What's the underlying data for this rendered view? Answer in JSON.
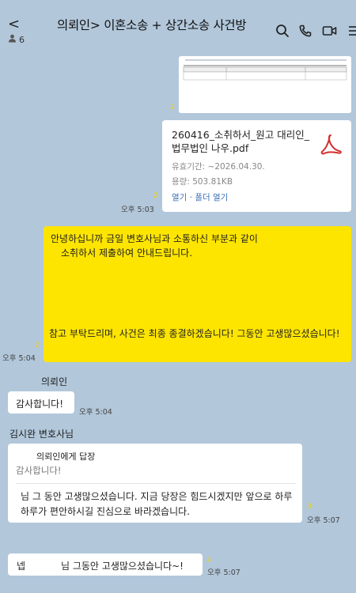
{
  "header": {
    "back": "<",
    "member_count": "6",
    "title": "의뢰인> 이혼소송 + 상간소송 사건방"
  },
  "messages": {
    "file": {
      "unread": "2",
      "name": "260416_소취하서_원고 대리인_법무법인 나우.pdf",
      "validity": "유효기간: ~2026.04.30.",
      "size": "용량: 503.81KB",
      "open": "열기",
      "sep": " · ",
      "folder": "폴더 열기",
      "time": "오후 5:03",
      "card_unread": "2"
    },
    "mine": {
      "line1": "안녕하십니까 금일 변호사님과 소통하신 부분과 같이",
      "line2": "소취하서 제출하여 안내드립니다.",
      "line3": "참고 부탁드리며, 사건은 최종 종결하겠습니다! 그동안 고생많으셨습니다!",
      "time": "오후 5:04",
      "unread": "2"
    },
    "client": {
      "sender": "의뢰인",
      "text": "감사합니다!",
      "time": "오후 5:04"
    },
    "lawyer": {
      "sender": "김시완 변호사님",
      "reply_to": "의뢰인에게 답장",
      "quote": "감사합니다!",
      "text": "님 그 동안 고생많으셨습니다. 지금 당장은 힘드시겠지만 앞으로 하루하루가 편안하시길 진심으로 바라겠습니다.",
      "unread": "3",
      "time": "오후 5:07"
    },
    "last": {
      "text_a": "넵",
      "text_b": "님 그동안 고생많으셨습니다~!",
      "unread": "4",
      "time": "오후 5:07"
    }
  },
  "colors": {
    "background": "#b2c7da",
    "my_bubble": "#fee500",
    "unread": "#f2d200",
    "link": "#3b6fb6",
    "pdf": "#d32f2f"
  }
}
